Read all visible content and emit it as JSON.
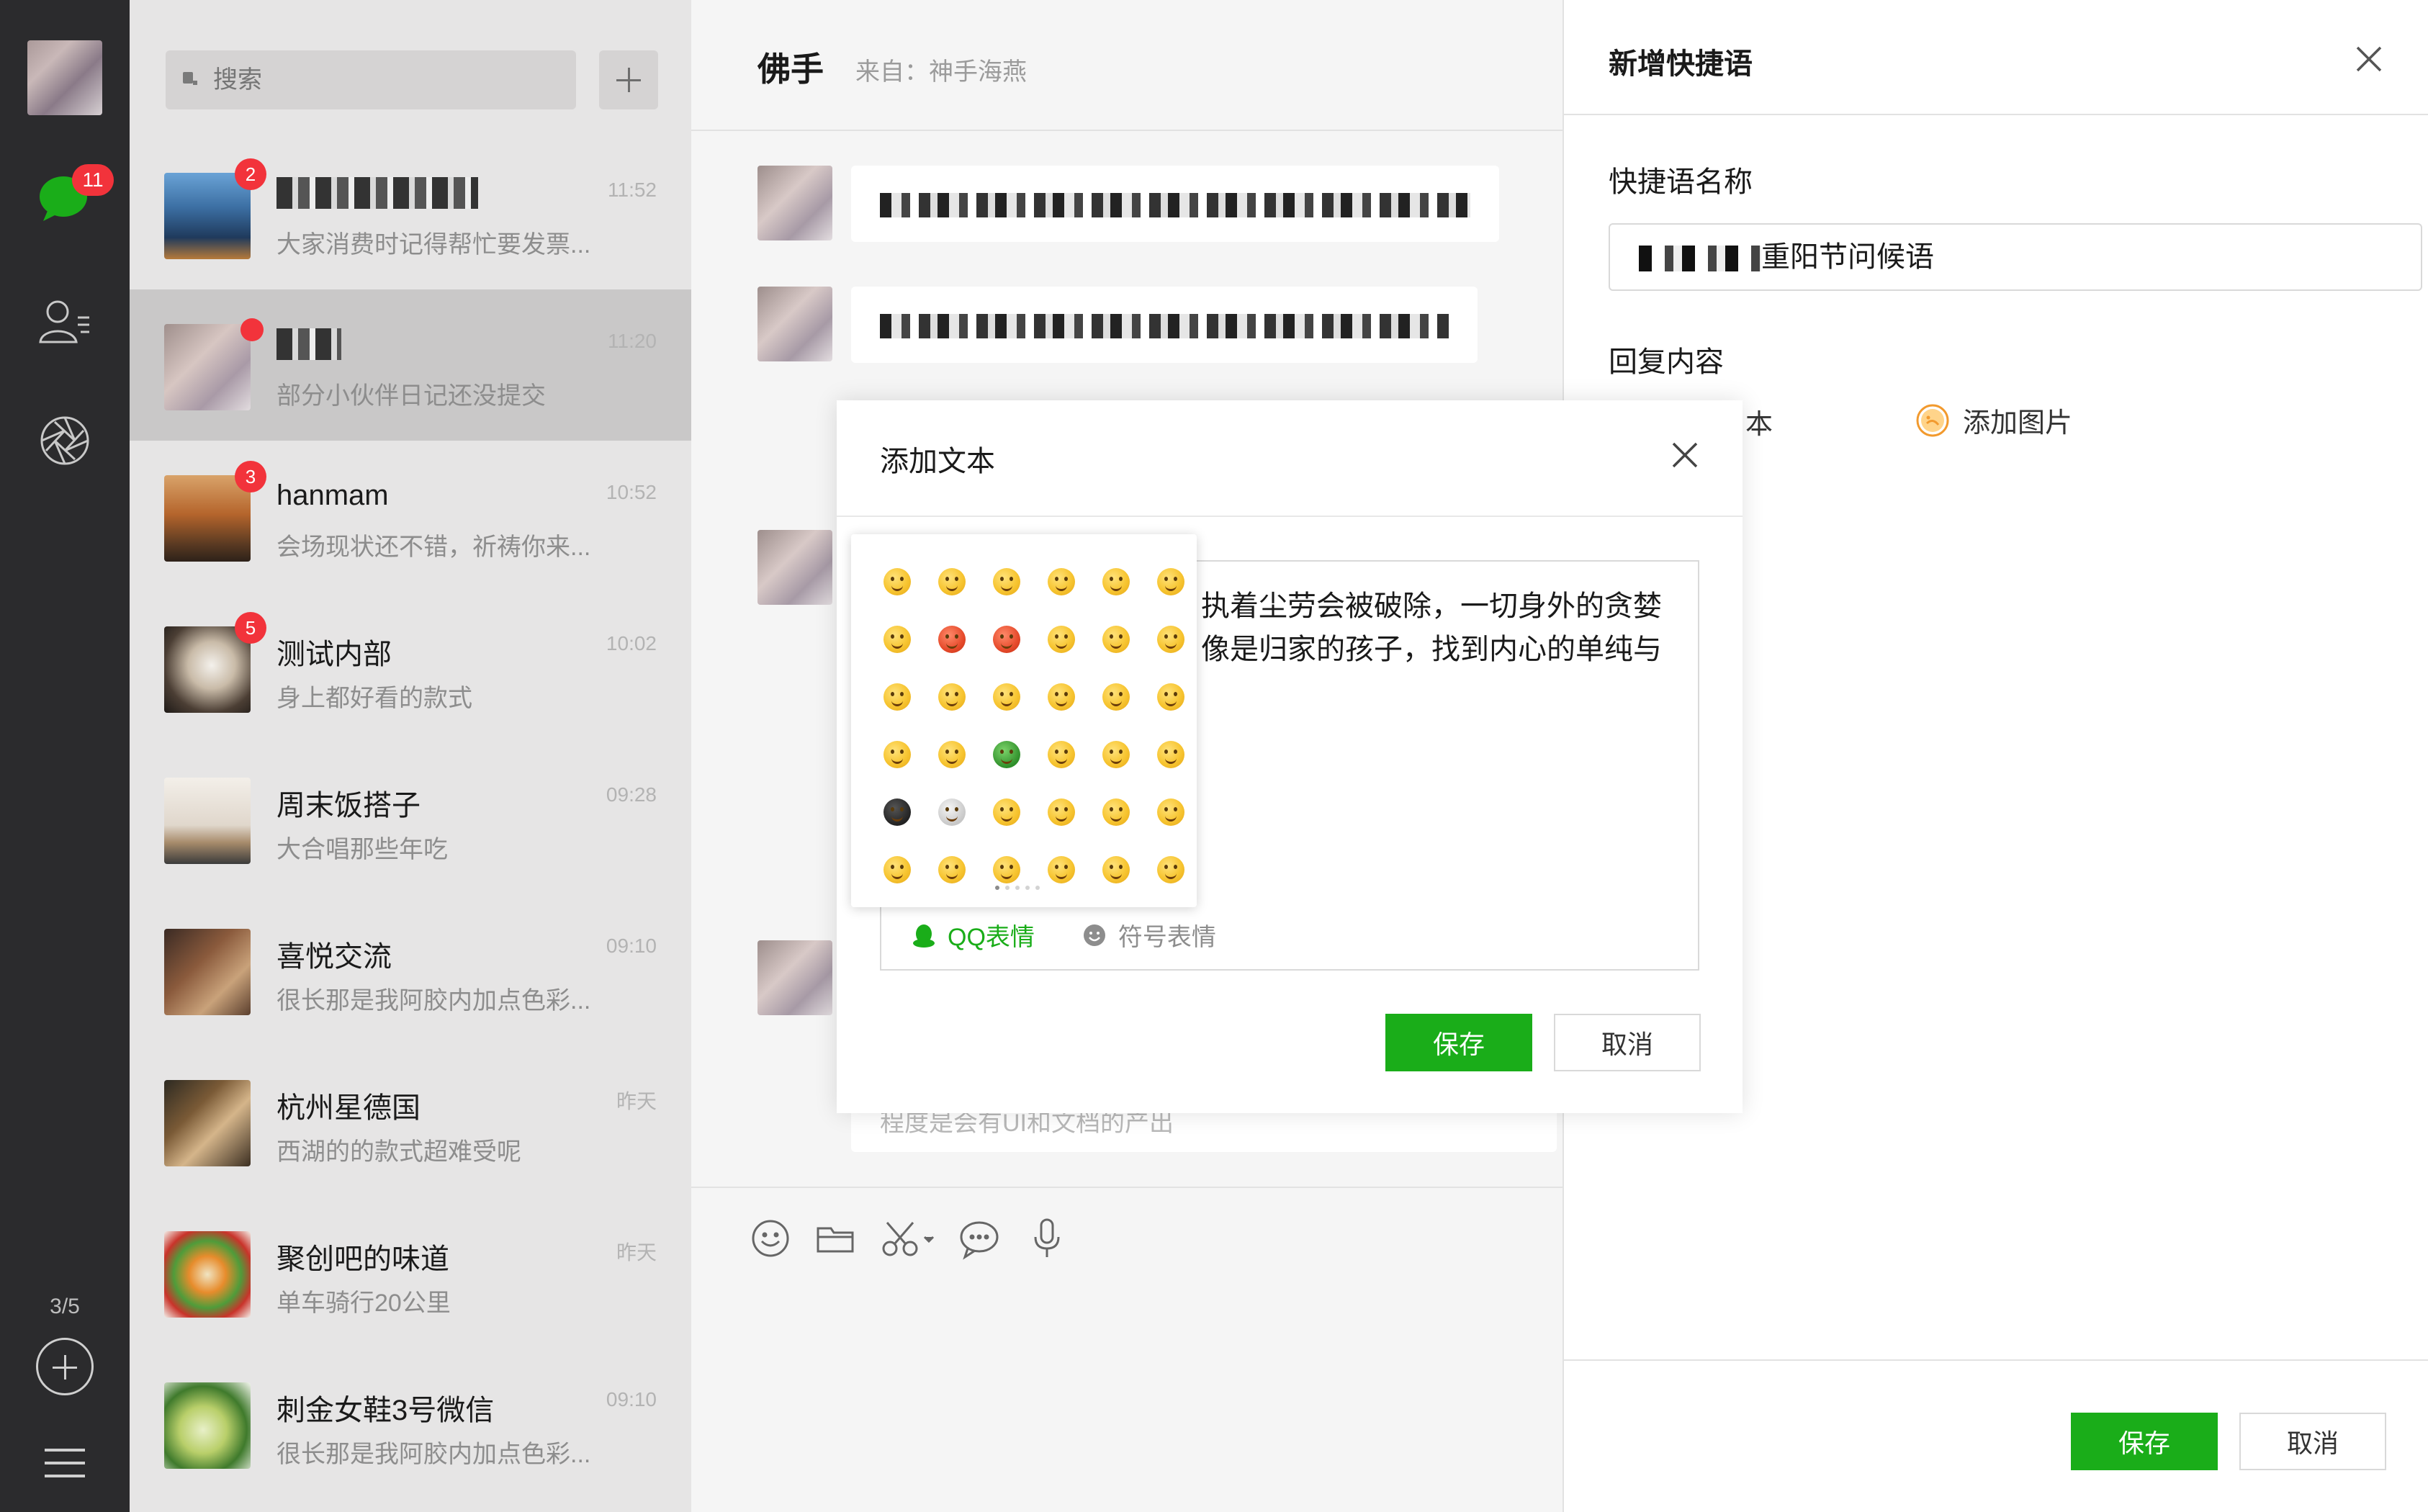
{
  "rail": {
    "unread_badge": "11",
    "pager": "3/5"
  },
  "search": {
    "placeholder": "搜索"
  },
  "conversations": [
    {
      "name": "",
      "time": "11:52",
      "preview": "大家消费时记得帮忙要发票...",
      "badge": "2",
      "name_redacted": true
    },
    {
      "name": "",
      "time": "11:20",
      "preview": "部分小伙伴日记还没提交",
      "badge": "",
      "name_redacted": true,
      "active": true
    },
    {
      "name": "hanmam",
      "time": "10:52",
      "preview": "会场现状还不错，祈祷你来...",
      "badge": "3"
    },
    {
      "name": "测试内部",
      "time": "10:02",
      "preview": "身上都好看的款式",
      "badge": "5"
    },
    {
      "name": "周末饭搭子",
      "time": "09:28",
      "preview": "大合唱那些年吃",
      "badge": ""
    },
    {
      "name": "喜悦交流",
      "time": "09:10",
      "preview": "很长那是我阿胶内加点色彩...",
      "badge": ""
    },
    {
      "name": "杭州星德国",
      "time": "昨天",
      "preview": "西湖的的款式超难受呢",
      "badge": ""
    },
    {
      "name": "聚创吧的味道",
      "time": "昨天",
      "preview": "单车骑行20公里",
      "badge": ""
    },
    {
      "name": "刺金女鞋3号微信",
      "time": "09:10",
      "preview": "很长那是我阿胶内加点色彩...",
      "badge": ""
    }
  ],
  "chat": {
    "title": "佛手",
    "from": "来自：神手海燕",
    "bottom_message": "程度是会有UI和文档的产出"
  },
  "quick_reply_panel": {
    "title": "新增快捷语",
    "name_label": "快捷语名称",
    "name_value": "重阳节问候语",
    "content_label": "回复内容",
    "add_text": "本",
    "add_image": "添加图片",
    "save": "保存",
    "cancel": "取消"
  },
  "add_text_dialog": {
    "title": "添加文本",
    "content": "执着尘劳会被破除，一切身外的贪婪像是归家的孩子，找到内心的单纯与",
    "tab_qq": "QQ表情",
    "tab_symbol": "符号表情",
    "save": "保存",
    "cancel": "取消"
  },
  "colors": {
    "accent_green": "#1aad19",
    "badge_red": "#f2333b",
    "rail_bg": "#2b2b2d",
    "list_bg": "#e6e5e5"
  }
}
